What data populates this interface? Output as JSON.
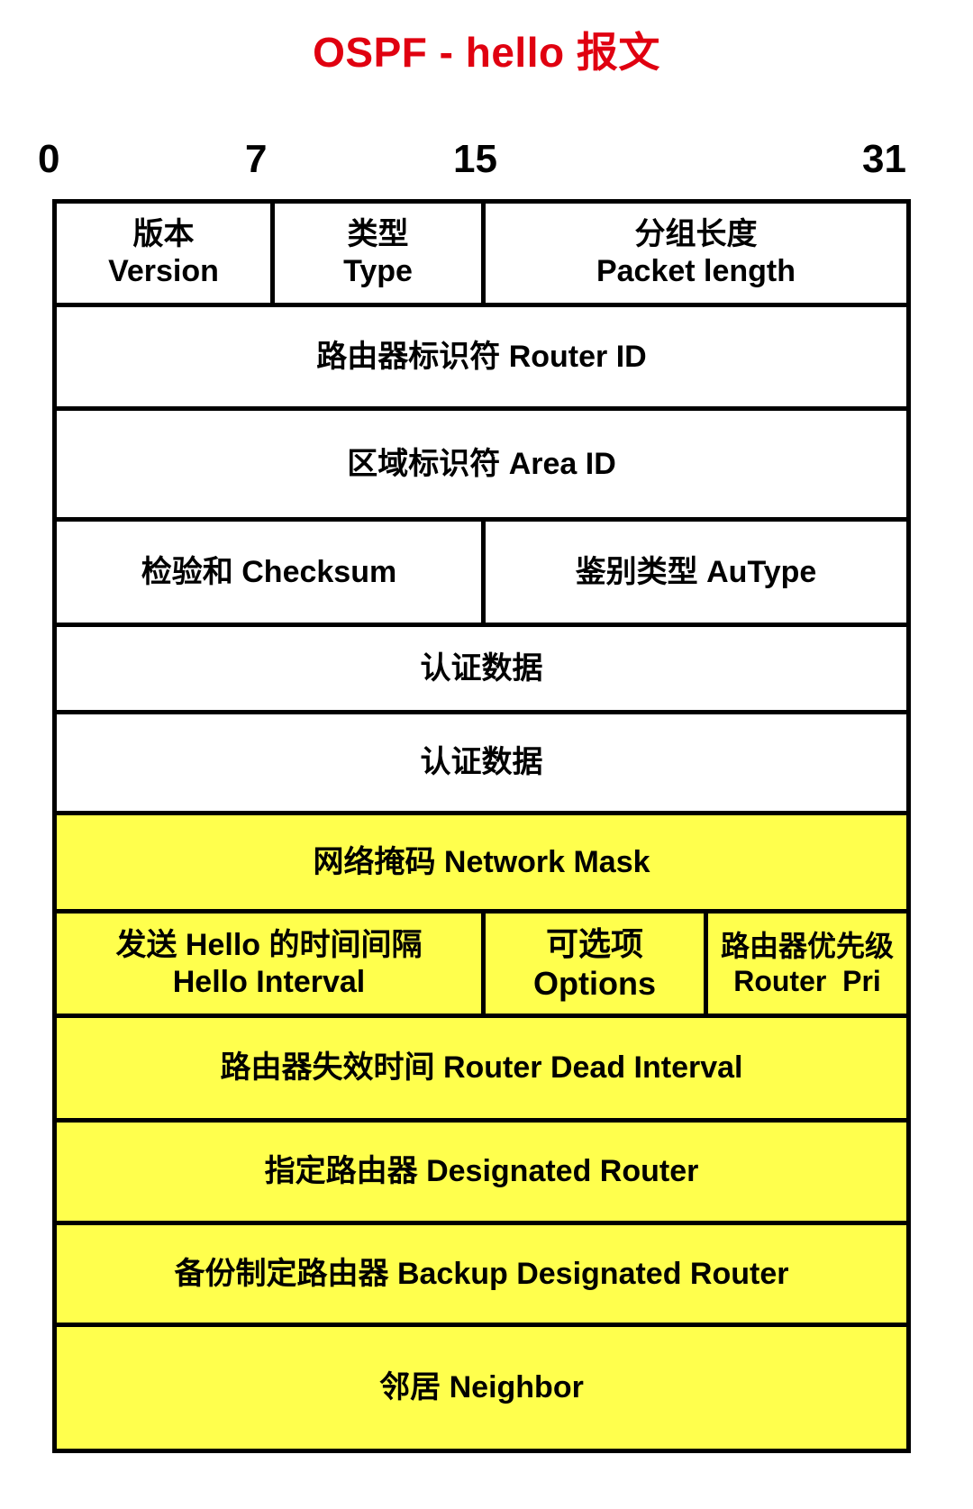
{
  "title": "OSPF - hello 报文",
  "colors": {
    "title": "#e00010",
    "header_fill": "#ffffff",
    "hello_fill": "#ffff4d",
    "border": "#000000"
  },
  "bit_markers": [
    "0",
    "7",
    "15",
    "31"
  ],
  "rows": {
    "version": {
      "zh": "版本",
      "en": "Version"
    },
    "type": {
      "zh": "类型",
      "en": "Type"
    },
    "packet_length": {
      "zh": "分组长度",
      "en": "Packet length"
    },
    "router_id": "路由器标识符 Router ID",
    "area_id": "区域标识符 Area ID",
    "checksum": "检验和 Checksum",
    "autype": "鉴别类型 AuType",
    "auth1": "认证数据",
    "auth2": "认证数据",
    "network_mask": "网络掩码 Network Mask",
    "hello_interval": {
      "zh": "发送 Hello 的时间间隔",
      "en": "Hello Interval"
    },
    "options": {
      "zh": "可选项",
      "en": "Options"
    },
    "router_pri": {
      "zh": "路由器优先级",
      "en": "Router  Pri"
    },
    "dead_interval": "路由器失效时间 Router Dead Interval",
    "designated_router": "指定路由器 Designated Router",
    "backup_designated_router": "备份制定路由器 Backup Designated Router",
    "neighbor": "邻居 Neighbor"
  }
}
